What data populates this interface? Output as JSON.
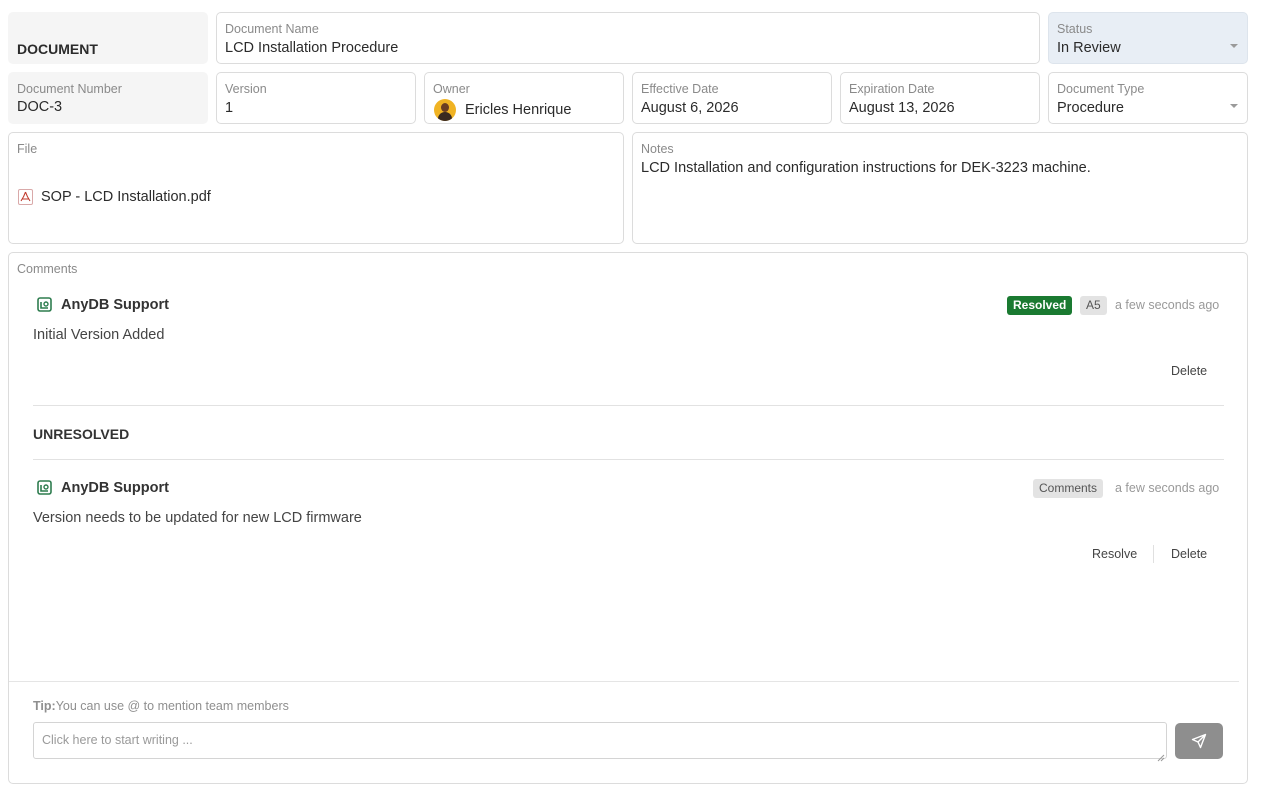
{
  "header": {
    "section_label": "DOCUMENT"
  },
  "fields": {
    "document_name": {
      "label": "Document Name",
      "value": "LCD Installation Procedure"
    },
    "status": {
      "label": "Status",
      "value": "In Review"
    },
    "document_number": {
      "label": "Document Number",
      "value": "DOC-3"
    },
    "version": {
      "label": "Version",
      "value": "1"
    },
    "owner": {
      "label": "Owner",
      "value": "Ericles Henrique"
    },
    "effective_date": {
      "label": "Effective Date",
      "value": "August 6, 2026"
    },
    "expiration_date": {
      "label": "Expiration Date",
      "value": "August 13, 2026"
    },
    "document_type": {
      "label": "Document Type",
      "value": "Procedure"
    },
    "file": {
      "label": "File",
      "name": "SOP - LCD Installation.pdf"
    },
    "notes": {
      "label": "Notes",
      "value": "LCD Installation and configuration instructions for DEK-3223 machine."
    }
  },
  "comments": {
    "label": "Comments",
    "resolved": [
      {
        "author": "AnyDB Support",
        "text": "Initial Version Added",
        "status_badge": "Resolved",
        "tag": "A5",
        "time": "a few seconds ago",
        "actions": [
          "Delete"
        ]
      }
    ],
    "unresolved_title": "UNRESOLVED",
    "unresolved": [
      {
        "author": "AnyDB Support",
        "text": "Version needs to be updated for new LCD firmware",
        "tag": "Comments",
        "time": "a few seconds ago",
        "actions": [
          "Resolve",
          "Delete"
        ]
      }
    ],
    "tip_prefix": "Tip:",
    "tip_text": "You can use @ to mention team members",
    "input_placeholder": "Click here to start writing ..."
  },
  "colors": {
    "resolved_badge": "#1a7a31",
    "status_bg": "#e8eef5",
    "send_button": "#8e8e8e",
    "brand_icon": "#2e7d4f"
  },
  "icons": {
    "owner_avatar": "avatar",
    "file": "pdf-icon",
    "author": "anydb-logo-icon",
    "send": "send-icon",
    "dropdown": "chevron-down-icon"
  }
}
